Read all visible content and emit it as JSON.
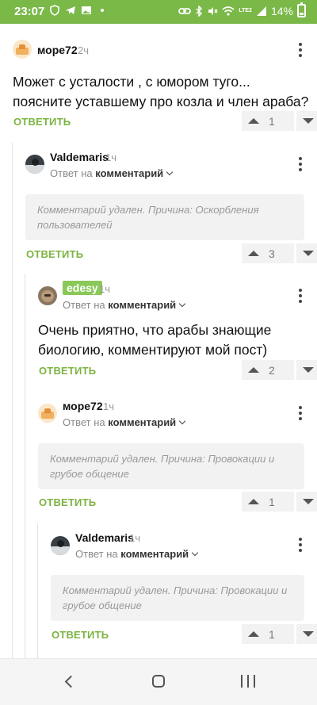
{
  "status_bar": {
    "time": "23:07",
    "battery": "14%",
    "icons_left": [
      "shield-icon",
      "telegram-icon",
      "image-icon",
      "dot-icon"
    ],
    "icons_right": [
      "link-icon",
      "bluetooth-icon",
      "mute-icon",
      "wifi-icon",
      "signal-icon",
      "battery-icon"
    ],
    "network_label": "LTE2"
  },
  "comments": [
    {
      "author": "море72",
      "time": "2ч",
      "text_lines": [
        "Может с усталости , с юмором туго...",
        "поясните уставшему про козла и член араба?"
      ],
      "reply_label": "ОТВЕТИТЬ",
      "votes": "1"
    },
    {
      "author": "Valdemaris",
      "time": "1ч",
      "reply_to_prefix": "Ответ на",
      "reply_to_target": "комментарий",
      "deleted_text": "Комментарий удален. Причина: Оскорбления пользователей",
      "reply_label": "ОТВЕТИТЬ",
      "votes": "3"
    },
    {
      "author": "edesy",
      "time": "1ч",
      "reply_to_prefix": "Ответ на",
      "reply_to_target": "комментарий",
      "text_lines": [
        "Очень приятно, что арабы знающие",
        "биологию, комментируют мой пост)"
      ],
      "reply_label": "ОТВЕТИТЬ",
      "votes": "2"
    },
    {
      "author": "море72",
      "time": "1ч",
      "reply_to_prefix": "Ответ на",
      "reply_to_target": "комментарий",
      "deleted_text": "Комментарий удален. Причина: Провокации и грубое общение",
      "reply_label": "ОТВЕТИТЬ",
      "votes": "1"
    },
    {
      "author": "Valdemaris",
      "time": "1ч",
      "reply_to_prefix": "Ответ на",
      "reply_to_target": "комментарий",
      "deleted_text": "Комментарий удален. Причина: Провокации и грубое общение",
      "reply_label": "ОТВЕТИТЬ",
      "votes": "1"
    }
  ],
  "colors": {
    "status_bar": "#7ab848",
    "accent_green": "#7cb342",
    "author_badge": "#8ac858"
  }
}
